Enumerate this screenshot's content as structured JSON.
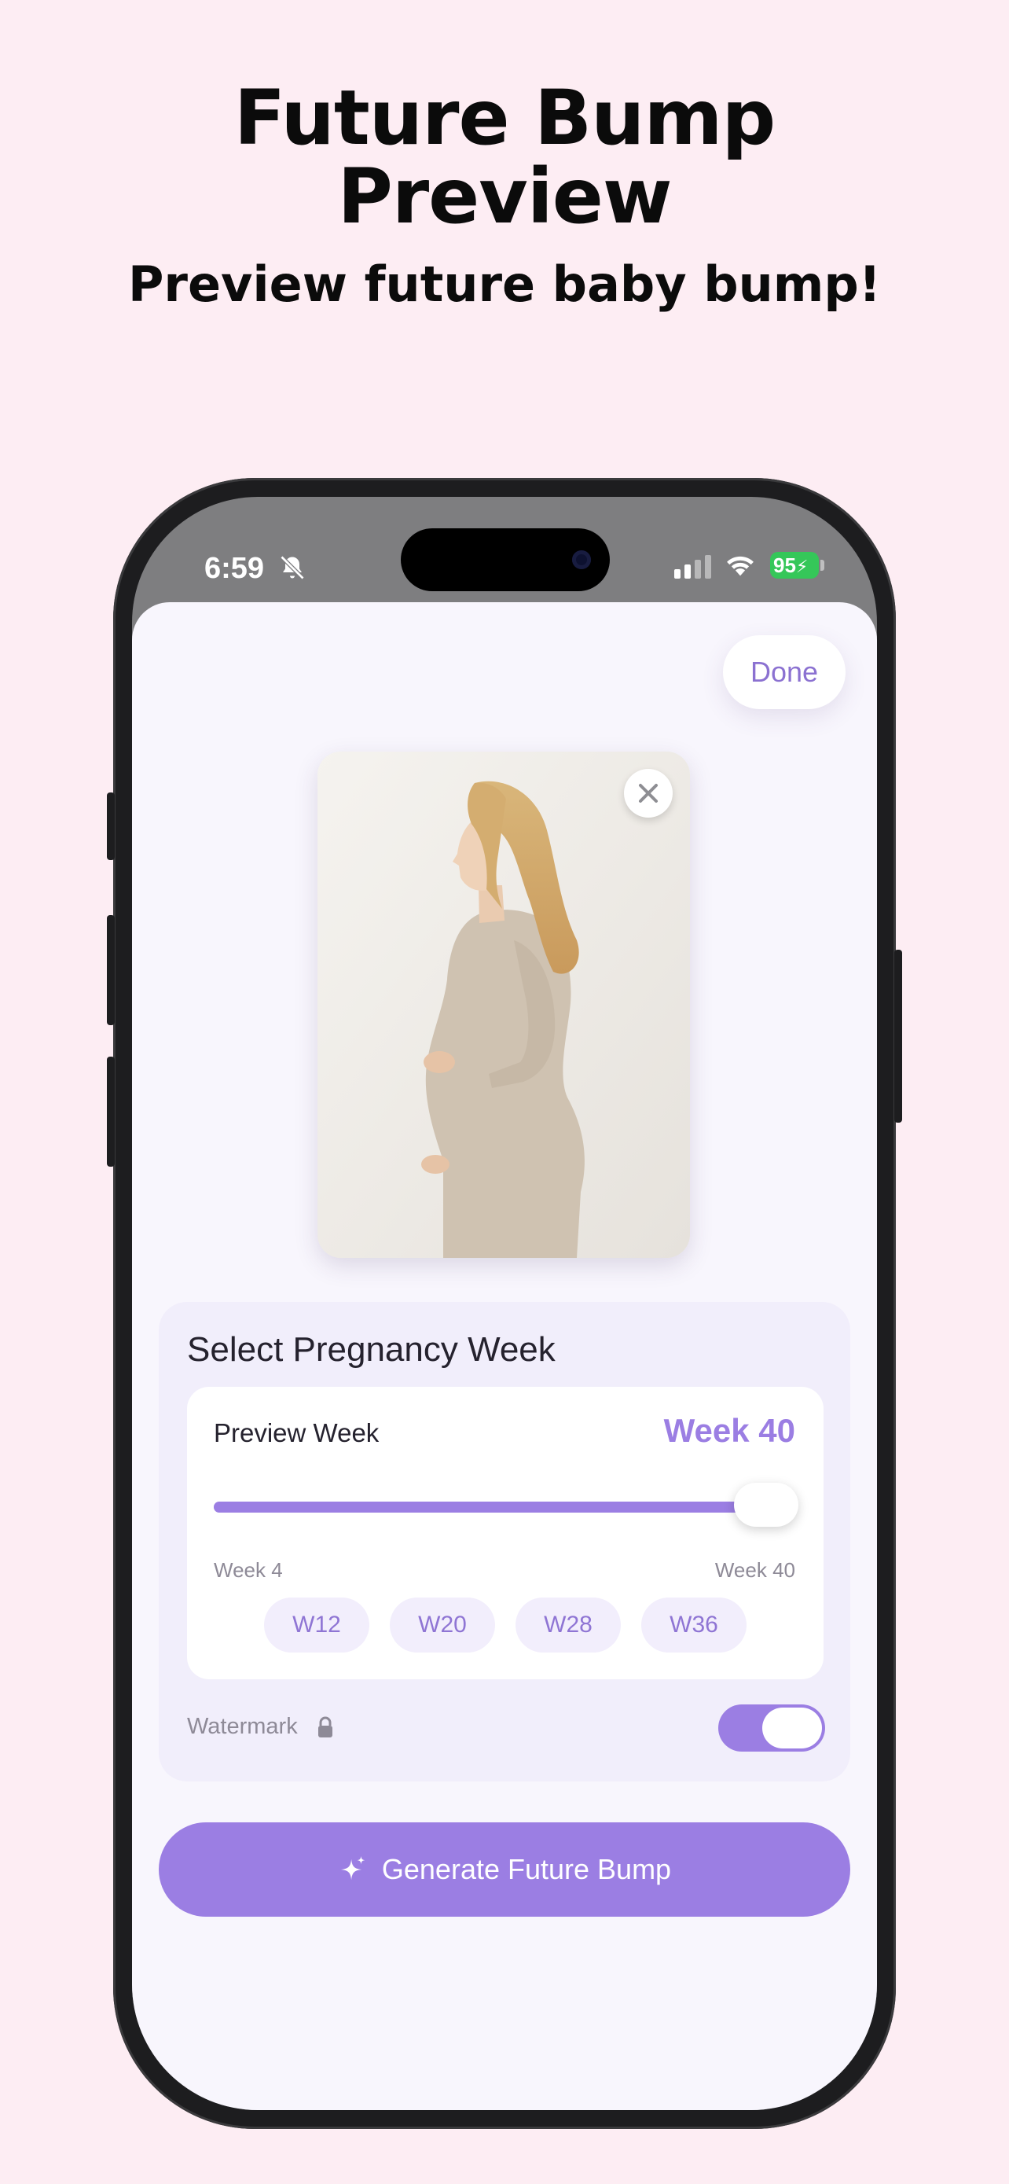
{
  "promo": {
    "title_line1": "Future Bump",
    "title_line2": "Preview",
    "subtitle": "Preview future baby bump!"
  },
  "status_bar": {
    "time": "6:59",
    "battery": "95",
    "icons": [
      "bell-slash-icon",
      "cellular-signal-icon",
      "wifi-icon",
      "battery-charging-icon"
    ]
  },
  "header": {
    "done_label": "Done"
  },
  "photo": {
    "close_icon": "close-icon"
  },
  "week_selector": {
    "title": "Select Pregnancy Week",
    "preview_label": "Preview Week",
    "current_value": "Week 40",
    "slider_fraction": 1.0,
    "range_min_label": "Week 4",
    "range_max_label": "Week 40",
    "quick_chips": [
      "W12",
      "W20",
      "W28",
      "W36"
    ]
  },
  "watermark": {
    "label": "Watermark",
    "icon": "lock-icon",
    "enabled": true
  },
  "generate": {
    "label": "Generate Future Bump",
    "icon": "sparkle-icon"
  },
  "colors": {
    "accent": "#9b7ee3",
    "background": "#fdedf3",
    "sheet": "#f8f6fd"
  }
}
